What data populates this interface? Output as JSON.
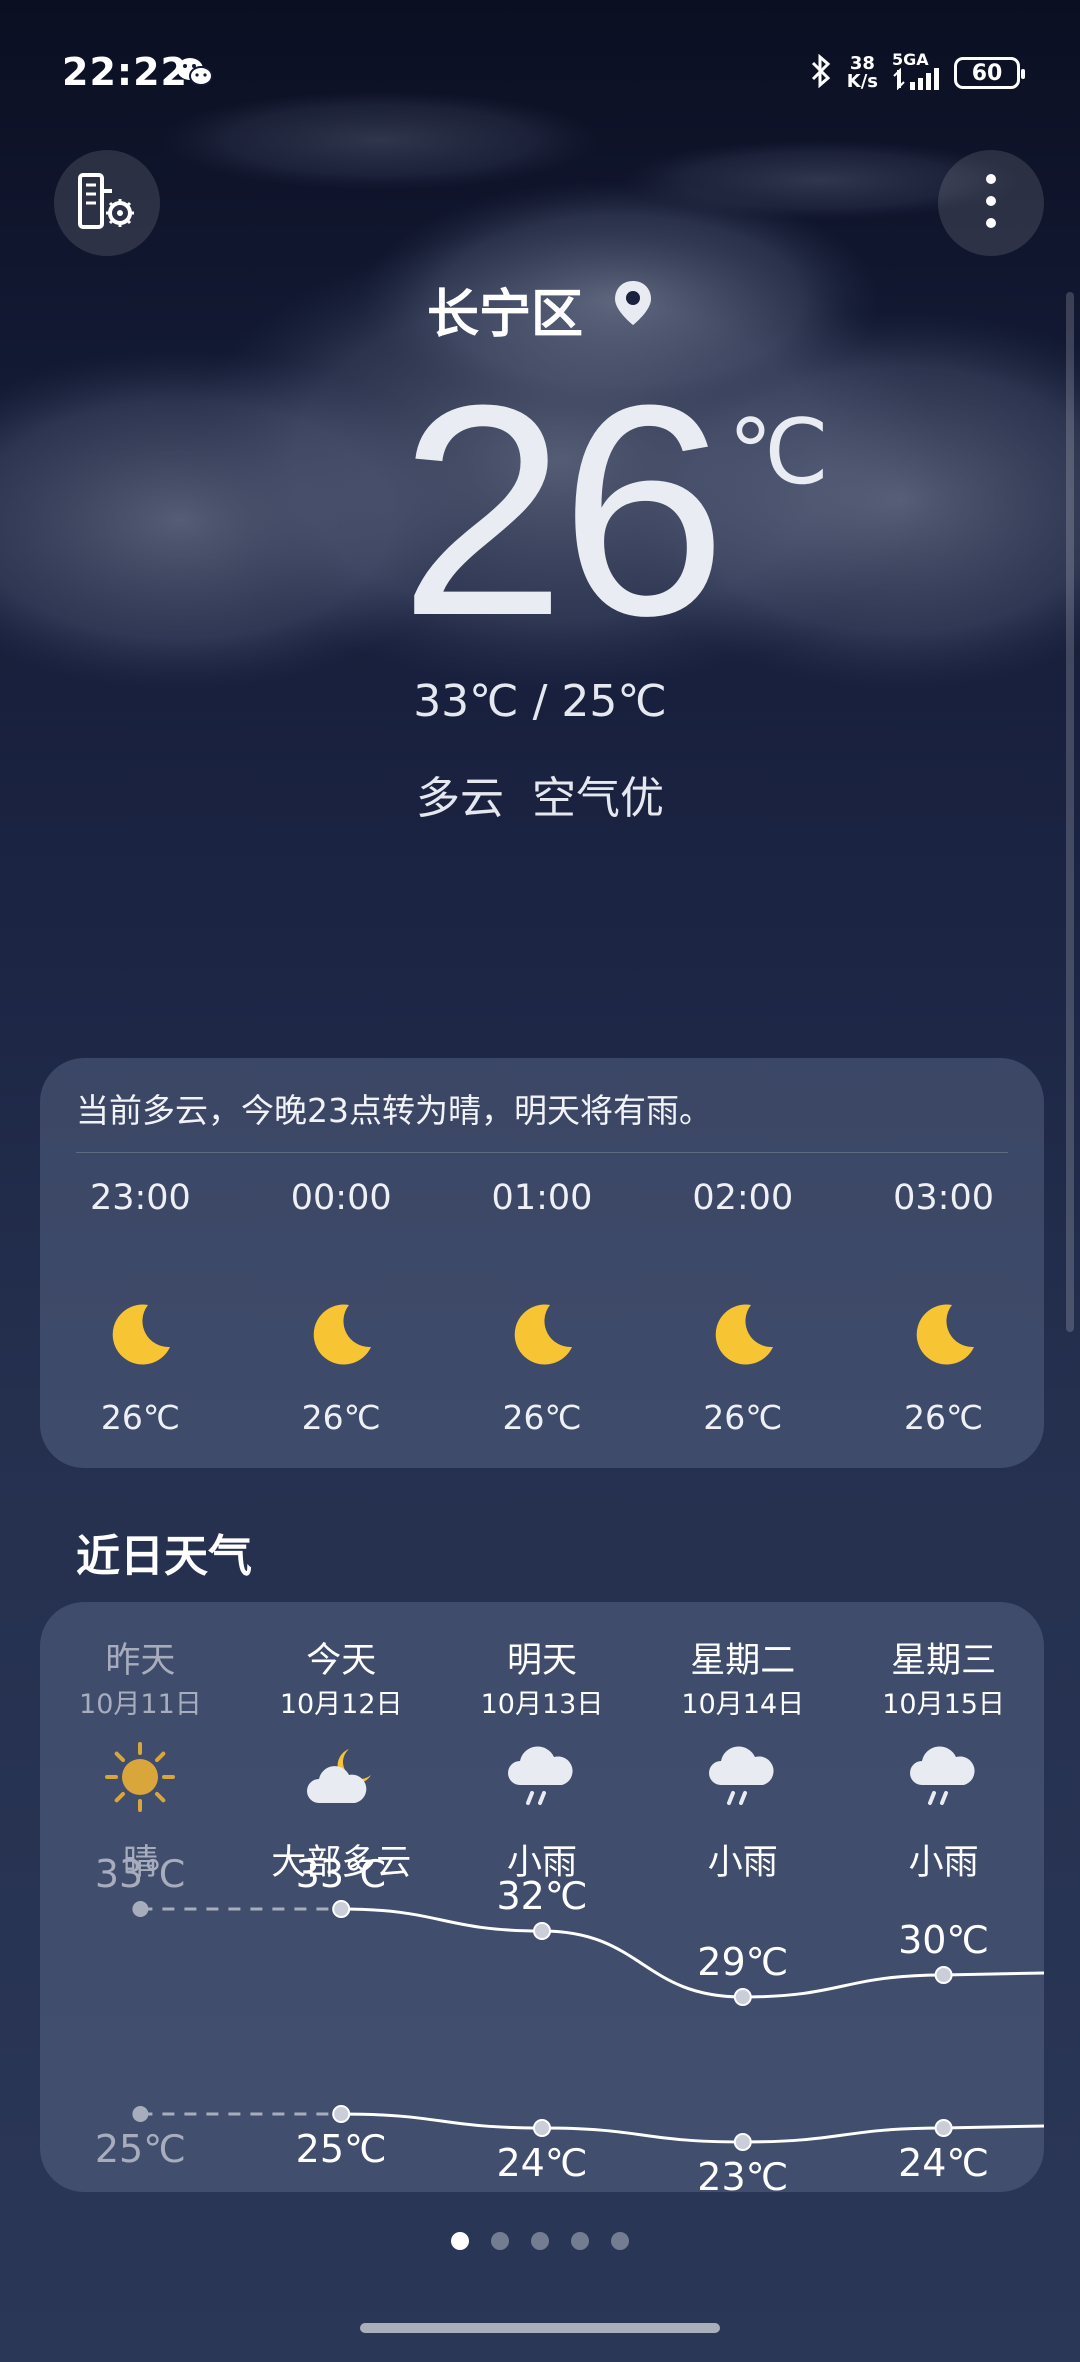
{
  "status_bar": {
    "time": "22:22",
    "net_speed_value": "38",
    "net_speed_unit": "K/s",
    "network_type": "5GA",
    "battery": "60"
  },
  "location": {
    "name": "长宁区"
  },
  "current": {
    "temperature": "26",
    "unit": "℃",
    "high_low": "33℃ / 25℃",
    "condition": "多云 空气优"
  },
  "hourly": {
    "summary": "当前多云，今晚23点转为晴，明天将有雨。",
    "items": [
      {
        "time": "23:00",
        "icon": "moon-icon",
        "temp": "26℃"
      },
      {
        "time": "00:00",
        "icon": "moon-icon",
        "temp": "26℃"
      },
      {
        "time": "01:00",
        "icon": "moon-icon",
        "temp": "26℃"
      },
      {
        "time": "02:00",
        "icon": "moon-icon",
        "temp": "26℃"
      },
      {
        "time": "03:00",
        "icon": "moon-icon",
        "temp": "26℃"
      }
    ]
  },
  "daily": {
    "title": "近日天气",
    "items": [
      {
        "name": "昨天",
        "date": "10月11日",
        "icon": "sun-icon",
        "condition": "晴",
        "high": "33℃",
        "low": "25℃",
        "high_value": 33,
        "low_value": 25
      },
      {
        "name": "今天",
        "date": "10月12日",
        "icon": "partly-cloudy-night-icon",
        "condition": "大部多云",
        "high": "33℃",
        "low": "25℃",
        "high_value": 33,
        "low_value": 25
      },
      {
        "name": "明天",
        "date": "10月13日",
        "icon": "light-rain-icon",
        "condition": "小雨",
        "high": "32℃",
        "low": "24℃",
        "high_value": 32,
        "low_value": 24
      },
      {
        "name": "星期二",
        "date": "10月14日",
        "icon": "light-rain-icon",
        "condition": "小雨",
        "high": "29℃",
        "low": "23℃",
        "high_value": 29,
        "low_value": 23
      },
      {
        "name": "星期三",
        "date": "10月15日",
        "icon": "light-rain-icon",
        "condition": "小雨",
        "high": "30℃",
        "low": "24℃",
        "high_value": 30,
        "low_value": 24
      }
    ]
  },
  "pager": {
    "count": 5,
    "active": 1
  },
  "colors": {
    "moon": "#f7c534",
    "sun": "#d8a63a",
    "cloud": "#e8ebf2"
  }
}
